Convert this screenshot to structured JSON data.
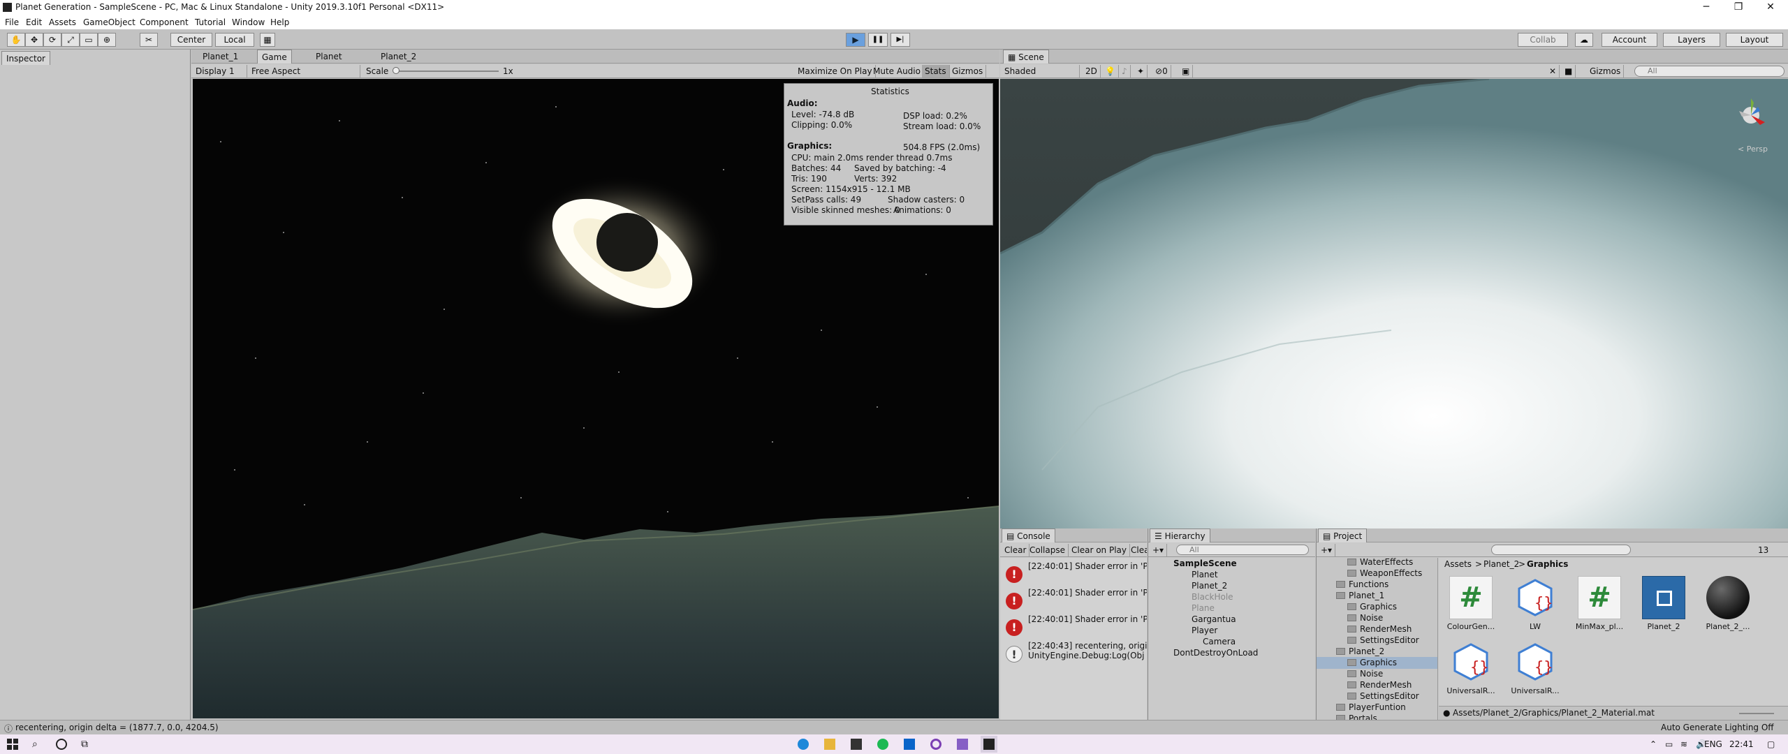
{
  "window": {
    "title": "Planet Generation - SampleScene - PC, Mac & Linux Standalone - Unity 2019.3.10f1 Personal <DX11>",
    "minimize": "─",
    "maximize": "❐",
    "close": "✕"
  },
  "menu": [
    "File",
    "Edit",
    "Assets",
    "GameObject",
    "Component",
    "Tutorial",
    "Window",
    "Help"
  ],
  "toolbar": {
    "pivot": "Center",
    "space": "Local",
    "collab": "Collab",
    "account": "Account",
    "layers": "Layers",
    "layout": "Layout",
    "play": "▶",
    "pause": "❚❚",
    "step": "▶|"
  },
  "inspector": {
    "tab": "Inspector"
  },
  "game_tabs": [
    "Planet_1",
    "Game",
    "Planet",
    "Planet_2"
  ],
  "game_bar": {
    "display": "Display 1",
    "aspect": "Free Aspect",
    "scale_label": "Scale",
    "scale_value": "1x",
    "maximize": "Maximize On Play",
    "mute": "Mute Audio",
    "stats": "Stats",
    "gizmos": "Gizmos"
  },
  "stats": {
    "title": "Statistics",
    "audio": "Audio:",
    "level": "Level: -74.8 dB",
    "clipping": "Clipping: 0.0%",
    "dsp": "DSP load: 0.2%",
    "stream": "Stream load: 0.0%",
    "graphics": "Graphics:",
    "fps": "504.8 FPS (2.0ms)",
    "cpu": "CPU: main 2.0ms  render thread 0.7ms",
    "batches": "Batches: 44",
    "saved": "Saved by batching: -4",
    "tris": "Tris: 190",
    "verts": "Verts: 392",
    "screen": "Screen: 1154x915 - 12.1 MB",
    "setpass": "SetPass calls: 49",
    "shadow": "Shadow casters: 0",
    "skinned": "Visible skinned meshes: 0",
    "anims": "Animations: 0"
  },
  "scene": {
    "tab": "Scene",
    "shading": "Shaded",
    "mode2d": "2D",
    "gizmos": "Gizmos",
    "search": "All",
    "persp": "< Persp",
    "gizmo_count": "0"
  },
  "console": {
    "tab": "Console",
    "buttons": [
      "Clear",
      "Collapse",
      "Clear on Play",
      "Clea"
    ],
    "entries": [
      {
        "time": "[22:40:01] Shader error in 'P",
        "type": "error"
      },
      {
        "time": "[22:40:01] Shader error in 'P",
        "type": "error"
      },
      {
        "time": "[22:40:01] Shader error in 'P",
        "type": "error"
      },
      {
        "time": "[22:40:43] recentering, origi",
        "sub": "UnityEngine.Debug:Log(Obj",
        "type": "info"
      }
    ]
  },
  "hierarchy": {
    "tab": "Hierarchy",
    "search": "All",
    "items": [
      {
        "label": "SampleScene",
        "depth": 0,
        "bold": true
      },
      {
        "label": "Planet",
        "depth": 1
      },
      {
        "label": "Planet_2",
        "depth": 1
      },
      {
        "label": "BlackHole",
        "depth": 1,
        "dim": true
      },
      {
        "label": "Plane",
        "depth": 1,
        "dim": true
      },
      {
        "label": "Gargantua",
        "depth": 1
      },
      {
        "label": "Player",
        "depth": 1
      },
      {
        "label": "Camera",
        "depth": 2
      },
      {
        "label": "DontDestroyOnLoad",
        "depth": 0
      }
    ]
  },
  "project": {
    "tab": "Project",
    "breadcrumb": [
      "Assets",
      "Planet_2",
      "Graphics"
    ],
    "count": "13",
    "folders": [
      {
        "label": "WaterEffects",
        "depth": 2
      },
      {
        "label": "WeaponEffects",
        "depth": 2
      },
      {
        "label": "Functions",
        "depth": 1
      },
      {
        "label": "Planet_1",
        "depth": 1
      },
      {
        "label": "Graphics",
        "depth": 2
      },
      {
        "label": "Noise",
        "depth": 2
      },
      {
        "label": "RenderMesh",
        "depth": 2
      },
      {
        "label": "SettingsEditor",
        "depth": 2
      },
      {
        "label": "Planet_2",
        "depth": 1
      },
      {
        "label": "Graphics",
        "depth": 2,
        "selected": true
      },
      {
        "label": "Noise",
        "depth": 2
      },
      {
        "label": "RenderMesh",
        "depth": 2
      },
      {
        "label": "SettingsEditor",
        "depth": 2
      },
      {
        "label": "PlayerFuntion",
        "depth": 1
      },
      {
        "label": "Portals",
        "depth": 1
      }
    ],
    "assets": [
      {
        "label": "ColourGen...",
        "kind": "script"
      },
      {
        "label": "LW",
        "kind": "shader"
      },
      {
        "label": "MinMax_pl...",
        "kind": "script"
      },
      {
        "label": "Planet_2",
        "kind": "object"
      },
      {
        "label": "Planet_2_...",
        "kind": "material"
      },
      {
        "label": "UniversalR...",
        "kind": "shader"
      },
      {
        "label": "UniversalR...",
        "kind": "shader"
      }
    ],
    "path": "Assets/Planet_2/Graphics/Planet_2_Material.mat"
  },
  "status": {
    "message": "recentering, origin delta = (1877.7, 0.0, 4204.5)",
    "lighting": "Auto Generate Lighting Off"
  },
  "taskbar": {
    "lang": "ENG",
    "time": "22:41"
  }
}
